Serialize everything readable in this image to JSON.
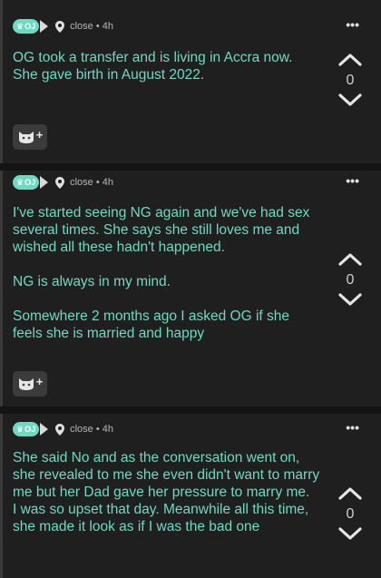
{
  "comments": [
    {
      "badge": "OJ",
      "meta": "close • 4h",
      "more": "•••",
      "text": "OG took a transfer and is living in Accra now.\nShe gave birth in August 2022.",
      "votes": "0"
    },
    {
      "badge": "OJ",
      "meta": "close • 4h",
      "more": "•••",
      "text": "I've started seeing NG again and we've had sex several times. She says she still loves me and wished all these hadn't happened.\n\nNG is always in my mind.\n\nSomewhere 2 months ago I asked OG if she feels she is married and happy",
      "votes": "0"
    },
    {
      "badge": "OJ",
      "meta": "close • 4h",
      "more": "•••",
      "text": "She said No and as the conversation went on, she revealed to me she even didn't want to marry me but her Dad gave her pressure to marry me.\nI was so upset that day. Meanwhile all this time, she made it look as if I was the bad one",
      "votes": "0"
    }
  ],
  "react_plus": "+",
  "colors": {
    "accent": "#6fd9c2",
    "background": "#1b1b1b",
    "text_secondary": "#b5b5b5"
  },
  "icons": [
    "crown-icon",
    "play-arrow-icon",
    "location-pin-icon",
    "more-dots-icon",
    "upvote-chevron-icon",
    "downvote-chevron-icon",
    "cat-reaction-icon"
  ]
}
